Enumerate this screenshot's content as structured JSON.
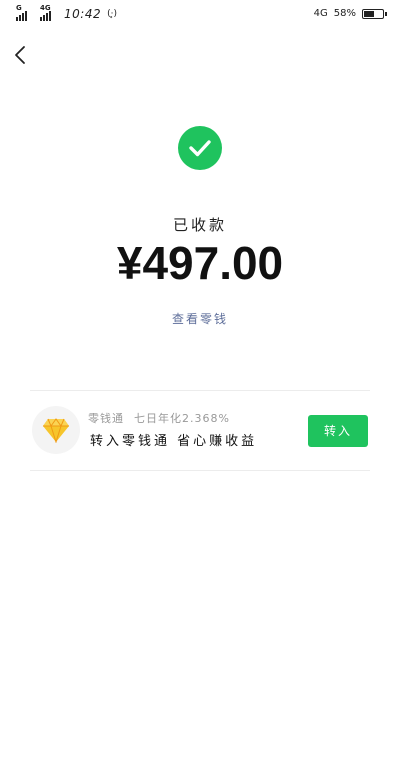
{
  "status_bar": {
    "sim1_label": "G",
    "sim2_label": "4G",
    "time": "10:42",
    "wifi_label": "(·̥)",
    "network_right": "4G",
    "battery": "58%",
    "battery_level": 0.58
  },
  "header": {
    "back_icon": "chevron-left-icon"
  },
  "result": {
    "icon": "check-icon",
    "status": "已收款",
    "amount": "¥497.00",
    "view_link": "查看零钱"
  },
  "promo": {
    "logo_icon": "diamond-icon",
    "title": "零钱通",
    "rate_text": "七日年化2.368%",
    "tagline": "转入零钱通 省心赚收益",
    "button_label": "转入"
  },
  "colors": {
    "accent_green": "#1fc35e",
    "link_blue": "#5e6e9a",
    "diamond_yellow": "#f6c52b"
  }
}
